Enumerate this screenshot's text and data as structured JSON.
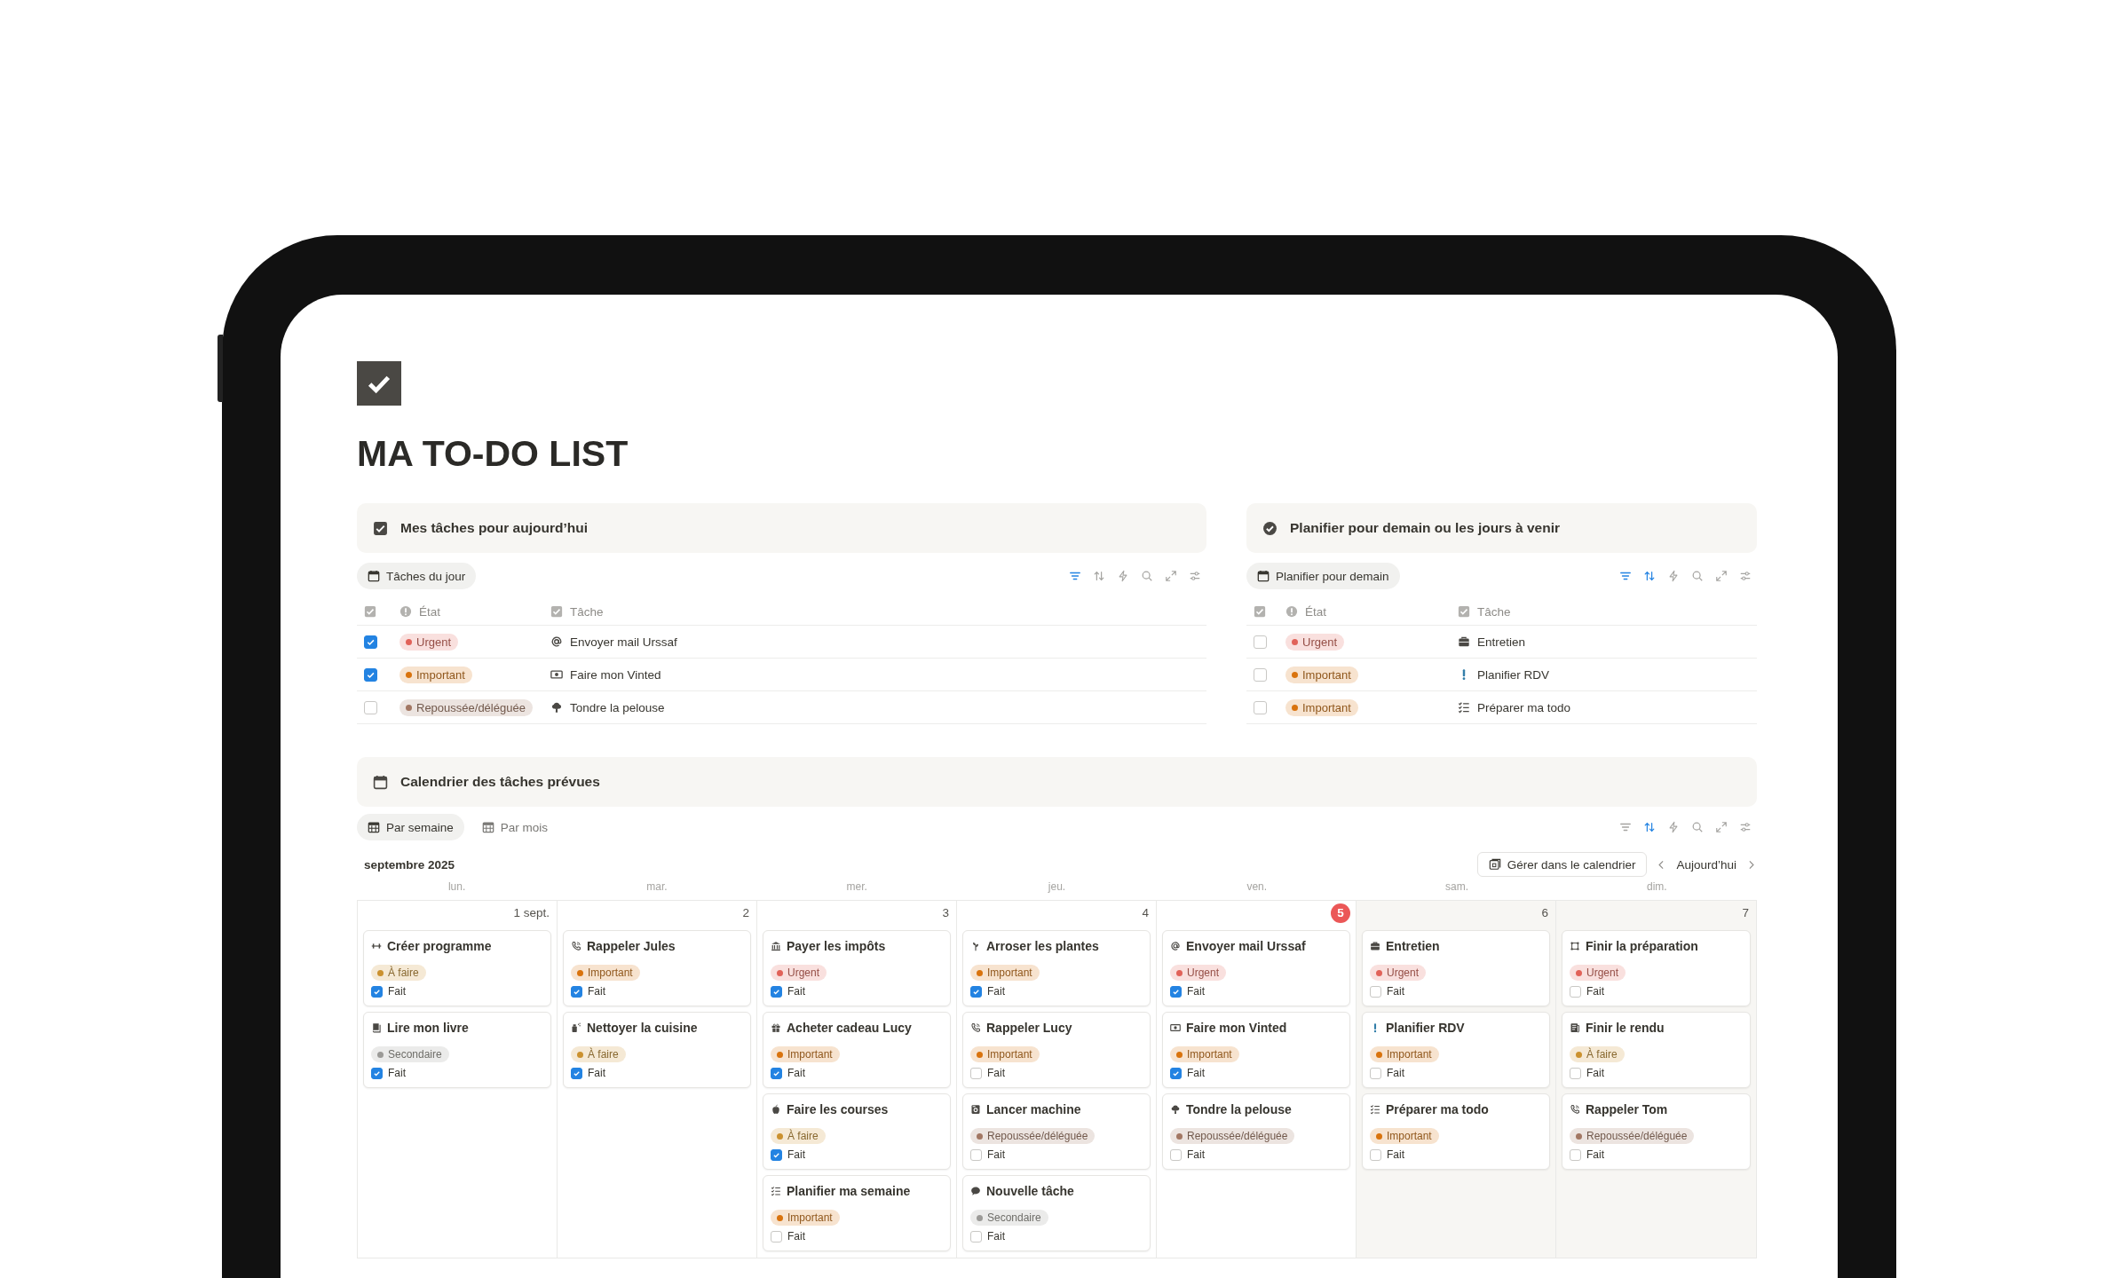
{
  "page": {
    "title": "MA TO-DO LIST"
  },
  "today": {
    "callout": {
      "kind": "checkbox",
      "title": "Mes tâches pour aujourd’hui"
    },
    "views": [
      {
        "label": "Tâches du jour",
        "selected": true
      }
    ],
    "toolbar": [
      {
        "kind": "filter",
        "active": true
      },
      {
        "kind": "sort",
        "active": false
      },
      {
        "kind": "bolt",
        "active": false
      },
      {
        "kind": "search",
        "active": false
      },
      {
        "kind": "expand",
        "active": false
      },
      {
        "kind": "sliders",
        "active": false
      }
    ],
    "columns": [
      {
        "kind": "done"
      },
      {
        "kind": "status",
        "label": "État"
      },
      {
        "kind": "title",
        "label": "Tâche"
      }
    ],
    "rows": [
      {
        "done": true,
        "status": {
          "label": "Urgent",
          "color": "#e16259"
        },
        "kind": "at",
        "title": "Envoyer mail Urssaf"
      },
      {
        "done": true,
        "status": {
          "label": "Important",
          "color": "#d9730d"
        },
        "kind": "banknote",
        "title": "Faire mon Vinted"
      },
      {
        "done": false,
        "status": {
          "label": "Repoussée/déléguée",
          "color": "#a27763"
        },
        "kind": "tree",
        "title": "Tondre la pelouse"
      }
    ]
  },
  "upcoming": {
    "callout": {
      "kind": "check-circle",
      "title": "Planifier pour demain ou les jours à venir"
    },
    "views": [
      {
        "label": "Planifier pour demain",
        "selected": true
      }
    ],
    "toolbar": [
      {
        "kind": "filter",
        "active": true
      },
      {
        "kind": "sort",
        "active": true
      },
      {
        "kind": "bolt",
        "active": false
      },
      {
        "kind": "search",
        "active": false
      },
      {
        "kind": "expand",
        "active": false
      },
      {
        "kind": "sliders",
        "active": false
      }
    ],
    "columns": [
      {
        "kind": "done"
      },
      {
        "kind": "status",
        "label": "État"
      },
      {
        "kind": "title",
        "label": "Tâche"
      }
    ],
    "rows": [
      {
        "done": false,
        "status": {
          "label": "Urgent",
          "color": "#e16259"
        },
        "kind": "briefcase",
        "title": "Entretien"
      },
      {
        "done": false,
        "status": {
          "label": "Important",
          "color": "#d9730d"
        },
        "kind": "exclamation",
        "title": "Planifier RDV"
      },
      {
        "done": false,
        "status": {
          "label": "Important",
          "color": "#d9730d"
        },
        "kind": "checklist",
        "title": "Préparer ma todo"
      }
    ]
  },
  "calendar": {
    "callout": {
      "kind": "calendar",
      "title": "Calendrier des tâches prévues"
    },
    "views": [
      {
        "label": "Par semaine",
        "selected": true
      },
      {
        "label": "Par mois",
        "selected": false
      }
    ],
    "toolbar": [
      {
        "kind": "filter",
        "active": false
      },
      {
        "kind": "sort",
        "active": true
      },
      {
        "kind": "bolt",
        "active": false
      },
      {
        "kind": "search",
        "active": false
      },
      {
        "kind": "expand",
        "active": false
      },
      {
        "kind": "sliders",
        "active": false
      }
    ],
    "month": "septembre 2025",
    "manage_button": "Gérer dans le calendrier",
    "today_button": "Aujourd’hui",
    "weekdays": [
      "lun.",
      "mar.",
      "mer.",
      "jeu.",
      "ven.",
      "sam.",
      "dim."
    ],
    "days": [
      {
        "label": "1 sept.",
        "today": false,
        "weekend": false,
        "tasks": [
          {
            "kind": "dumbbell",
            "title": "Créer programme",
            "status": {
              "label": "À faire",
              "color": "#cb912f"
            },
            "done": true,
            "done_label": "Fait"
          },
          {
            "kind": "book",
            "title": "Lire mon livre",
            "status": {
              "label": "Secondaire",
              "color": "#9b9a97"
            },
            "done": true,
            "done_label": "Fait"
          }
        ]
      },
      {
        "label": "2",
        "today": false,
        "weekend": false,
        "tasks": [
          {
            "kind": "phone",
            "title": "Rappeler Jules",
            "status": {
              "label": "Important",
              "color": "#d9730d"
            },
            "done": true,
            "done_label": "Fait"
          },
          {
            "kind": "spray",
            "title": "Nettoyer la cuisine",
            "status": {
              "label": "À faire",
              "color": "#cb912f"
            },
            "done": true,
            "done_label": "Fait"
          }
        ]
      },
      {
        "label": "3",
        "today": false,
        "weekend": false,
        "tasks": [
          {
            "kind": "bank",
            "title": "Payer les impôts",
            "status": {
              "label": "Urgent",
              "color": "#e16259"
            },
            "done": true,
            "done_label": "Fait"
          },
          {
            "kind": "gift",
            "title": "Acheter cadeau Lucy",
            "status": {
              "label": "Important",
              "color": "#d9730d"
            },
            "done": true,
            "done_label": "Fait"
          },
          {
            "kind": "apple",
            "title": "Faire les courses",
            "status": {
              "label": "À faire",
              "color": "#cb912f"
            },
            "done": true,
            "done_label": "Fait"
          },
          {
            "kind": "checklist",
            "title": "Planifier ma semaine",
            "status": {
              "label": "Important",
              "color": "#d9730d"
            },
            "done": false,
            "done_label": "Fait"
          }
        ]
      },
      {
        "label": "4",
        "today": false,
        "weekend": false,
        "tasks": [
          {
            "kind": "plant",
            "title": "Arroser les plantes",
            "status": {
              "label": "Important",
              "color": "#d9730d"
            },
            "done": true,
            "done_label": "Fait"
          },
          {
            "kind": "phone",
            "title": "Rappeler Lucy",
            "status": {
              "label": "Important",
              "color": "#d9730d"
            },
            "done": false,
            "done_label": "Fait"
          },
          {
            "kind": "washer",
            "title": "Lancer machine",
            "status": {
              "label": "Repoussée/déléguée",
              "color": "#a27763"
            },
            "done": false,
            "done_label": "Fait"
          },
          {
            "kind": "chat",
            "title": "Nouvelle tâche",
            "status": {
              "label": "Secondaire",
              "color": "#9b9a97"
            },
            "done": false,
            "done_label": "Fait"
          }
        ]
      },
      {
        "label": "5",
        "today": true,
        "weekend": false,
        "tasks": [
          {
            "kind": "at",
            "title": "Envoyer mail Urssaf",
            "status": {
              "label": "Urgent",
              "color": "#e16259"
            },
            "done": true,
            "done_label": "Fait"
          },
          {
            "kind": "banknote",
            "title": "Faire mon Vinted",
            "status": {
              "label": "Important",
              "color": "#d9730d"
            },
            "done": true,
            "done_label": "Fait"
          },
          {
            "kind": "tree",
            "title": "Tondre la pelouse",
            "status": {
              "label": "Repoussée/déléguée",
              "color": "#a27763"
            },
            "done": false,
            "done_label": "Fait"
          }
        ]
      },
      {
        "label": "6",
        "today": false,
        "weekend": true,
        "tasks": [
          {
            "kind": "briefcase",
            "title": "Entretien",
            "status": {
              "label": "Urgent",
              "color": "#e16259"
            },
            "done": false,
            "done_label": "Fait"
          },
          {
            "kind": "exclamation",
            "title": "Planifier RDV",
            "status": {
              "label": "Important",
              "color": "#d9730d"
            },
            "done": false,
            "done_label": "Fait"
          },
          {
            "kind": "checklist",
            "title": "Préparer ma todo",
            "status": {
              "label": "Important",
              "color": "#d9730d"
            },
            "done": false,
            "done_label": "Fait"
          }
        ]
      },
      {
        "label": "7",
        "today": false,
        "weekend": true,
        "tasks": [
          {
            "kind": "frame",
            "title": "Finir la préparation",
            "status": {
              "label": "Urgent",
              "color": "#e16259"
            },
            "done": false,
            "done_label": "Fait"
          },
          {
            "kind": "document",
            "title": "Finir le rendu",
            "status": {
              "label": "À faire",
              "color": "#cb912f"
            },
            "done": false,
            "done_label": "Fait"
          },
          {
            "kind": "phone",
            "title": "Rappeler Tom",
            "status": {
              "label": "Repoussée/déléguée",
              "color": "#a27763"
            },
            "done": false,
            "done_label": "Fait"
          }
        ]
      }
    ]
  }
}
